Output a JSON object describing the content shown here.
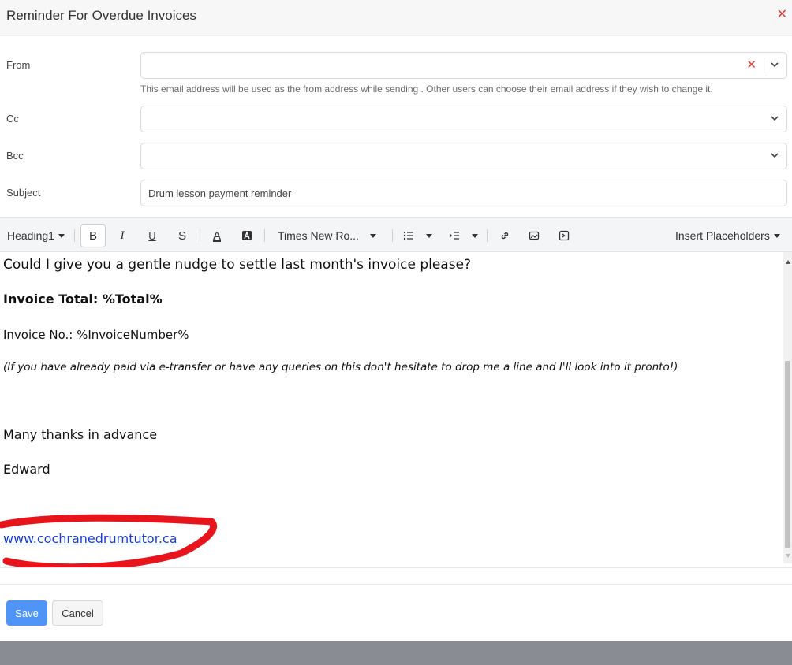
{
  "dialog": {
    "title": "Reminder For Overdue Invoices",
    "close_glyph": "✕"
  },
  "form": {
    "from_label": "From",
    "from_value": "",
    "from_hint": "This email address will be used as the from address while sending . Other users can choose their email address if they wish to change it.",
    "cc_label": "Cc",
    "bcc_label": "Bcc",
    "subject_label": "Subject",
    "subject_value": "Drum lesson payment reminder"
  },
  "toolbar": {
    "heading": "Heading1",
    "bold": "B",
    "italic": "I",
    "underline": "U",
    "strikethrough": "S",
    "font_color": "A",
    "font": "Times New Ro...",
    "insert_placeholders": "Insert Placeholders"
  },
  "body": {
    "line1": "Could I give you  a gentle nudge to settle last month's invoice please?",
    "line2": "Invoice Total: %Total%",
    "line3": "Invoice No.:  %InvoiceNumber%",
    "line4": "(If you have already paid via e-transfer or have any queries on this don't hesitate to drop me a line and I'll look into it pronto!)",
    "line5": "Many thanks in advance",
    "line6": "Edward",
    "link": "www.cochranedrumtutor.ca"
  },
  "actions": {
    "save": "Save",
    "cancel": "Cancel"
  },
  "colors": {
    "accent": "#4f95f7",
    "danger": "#e53935",
    "link": "#1a3dd6",
    "annotation": "#e8141b"
  }
}
